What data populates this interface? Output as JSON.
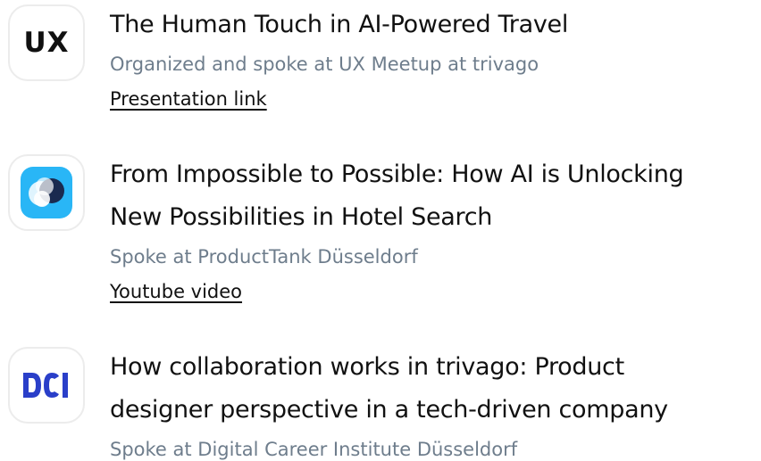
{
  "talks": [
    {
      "logo": "UX",
      "title": "The Human Touch in AI-Powered Travel",
      "subtitle": "Organized and spoke at UX Meetup at trivago",
      "link": "Presentation link"
    },
    {
      "logo_icon": "producttank-icon",
      "title_line1": "From Impossible to Possible: How AI is Unlocking",
      "title_line2": "New Possibilities in Hotel Search",
      "subtitle": "Spoke at ProductTank Düsseldorf",
      "link": "Youtube video"
    },
    {
      "logo_icon": "dci-icon",
      "title_line1": "How collaboration works in trivago: Product",
      "title_line2": "designer perspective in a tech-driven company",
      "subtitle": "Spoke at Digital Career Institute Düsseldorf"
    }
  ],
  "colors": {
    "title": "#111111",
    "subtitle": "#6e7d8c",
    "producttank_blue": "#29b6f6",
    "producttank_dark": "#1a2a4f",
    "dci_blue": "#2a3fc9"
  }
}
